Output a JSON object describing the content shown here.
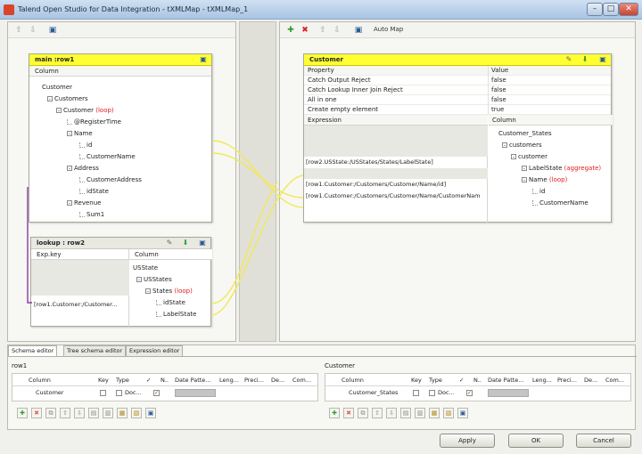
{
  "window": {
    "title": "Talend Open Studio for Data Integration - tXMLMap - tXMLMap_1",
    "buttons": {
      "minimize": "–",
      "maximize": "□",
      "close": "✕"
    }
  },
  "left_toolbar": {
    "icons": [
      "up-arrow",
      "down-arrow",
      "properties"
    ]
  },
  "right_toolbar": {
    "icons": [
      "add",
      "remove",
      "up-arrow",
      "down-arrow",
      "auto-map"
    ],
    "auto_map_label": "Auto Map"
  },
  "main_table": {
    "title": "main :row1",
    "column_header": "Column",
    "nodes": [
      {
        "label": "Customer",
        "loop": ""
      },
      {
        "label": "Customers",
        "loop": ""
      },
      {
        "label": "Customer",
        "loop": "(loop)"
      },
      {
        "label": "@RegisterTime",
        "loop": ""
      },
      {
        "label": "Name",
        "loop": ""
      },
      {
        "label": "id",
        "loop": ""
      },
      {
        "label": "CustomerName",
        "loop": ""
      },
      {
        "label": "Address",
        "loop": ""
      },
      {
        "label": "CustomerAddress",
        "loop": ""
      },
      {
        "label": "idState",
        "loop": ""
      },
      {
        "label": "Revenue",
        "loop": ""
      },
      {
        "label": "Sum1",
        "loop": ""
      }
    ]
  },
  "lookup_table": {
    "title": "lookup : row2",
    "col_exp": "Exp.key",
    "col_column": "Column",
    "expression": "[row1.Customer:/Customer...",
    "nodes": [
      {
        "label": "USState",
        "loop": ""
      },
      {
        "label": "USStates",
        "loop": ""
      },
      {
        "label": "States",
        "loop": "(loop)"
      },
      {
        "label": "idState",
        "loop": ""
      },
      {
        "label": "LabelState",
        "loop": ""
      }
    ]
  },
  "output_table": {
    "title": "Customer",
    "prop_header": "Property",
    "value_header": "Value",
    "properties": [
      {
        "name": "Catch Output Reject",
        "value": "false"
      },
      {
        "name": "Catch Lookup Inner Join Reject",
        "value": "false"
      },
      {
        "name": "All in one",
        "value": "false"
      },
      {
        "name": "Create empty element",
        "value": "true"
      }
    ],
    "expr_header": "Expression",
    "col_header": "Column",
    "expressions": [
      "[row2.USState:/USStates/States/LabelState]",
      "[row1.Customer:/Customers/Customer/Name/id]",
      "[row1.Customer:/Customers/Customer/Name/CustomerNam"
    ],
    "nodes": [
      {
        "label": "Customer_States",
        "note": ""
      },
      {
        "label": "customers",
        "note": ""
      },
      {
        "label": "customer",
        "note": ""
      },
      {
        "label": "LabelState",
        "note": "(aggregate)"
      },
      {
        "label": "Name",
        "note": "(loop)"
      },
      {
        "label": "id",
        "note": ""
      },
      {
        "label": "CustomerName",
        "note": ""
      }
    ]
  },
  "editor": {
    "tabs": [
      "Schema editor",
      "Tree schema editor",
      "Expression editor"
    ],
    "left": {
      "label": "row1",
      "headers": [
        "Column",
        "Key",
        "Type",
        "✓",
        "N..",
        "Date Patte...",
        "Leng...",
        "Preci...",
        "De...",
        "Com..."
      ],
      "row": {
        "column": "Customer",
        "type": "Doc...",
        "nullable": "✓"
      }
    },
    "right": {
      "label": "Customer",
      "headers": [
        "Column",
        "Key",
        "Type",
        "✓",
        "N..",
        "Date Patte...",
        "Leng...",
        "Preci...",
        "De...",
        "Com..."
      ],
      "row": {
        "column": "Customer_States",
        "type": "Doc...",
        "nullable": "✓"
      }
    }
  },
  "dialog_buttons": {
    "apply": "Apply",
    "ok": "OK",
    "cancel": "Cancel"
  },
  "colors": {
    "table_header": "#ffff33",
    "link_line": "#f2e85a",
    "loop_text": "#e02020"
  }
}
